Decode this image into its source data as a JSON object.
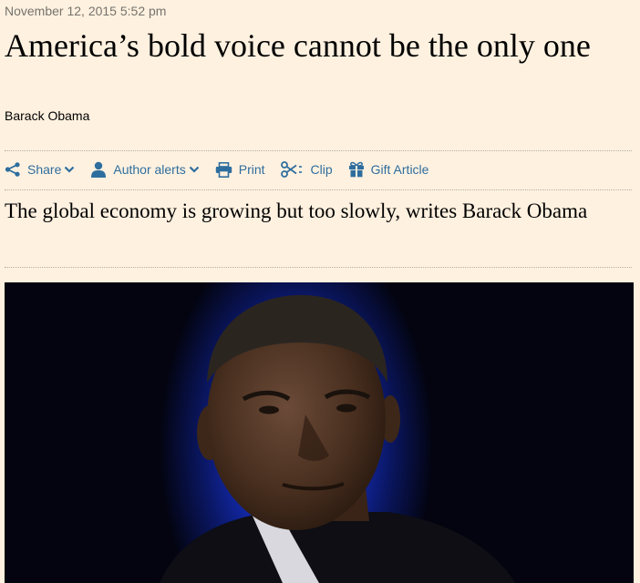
{
  "article": {
    "dateline": "November 12, 2015 5:52 pm",
    "headline": "America’s bold voice cannot be the only one",
    "byline": "Barack Obama",
    "standfirst": "The global economy is growing but too slowly, writes Barack Obama"
  },
  "toolbar": {
    "share_label": "Share",
    "author_alerts_label": "Author alerts",
    "print_label": "Print",
    "clip_label": "Clip",
    "gift_label": "Gift Article"
  },
  "icons": [
    "share-icon",
    "chevron-down-icon",
    "user-icon",
    "print-icon",
    "scissors-icon",
    "gift-icon"
  ],
  "colors": {
    "background": "#fff1e0",
    "link": "#2e6e9e",
    "dateline": "#74736c",
    "text": "#000000"
  }
}
